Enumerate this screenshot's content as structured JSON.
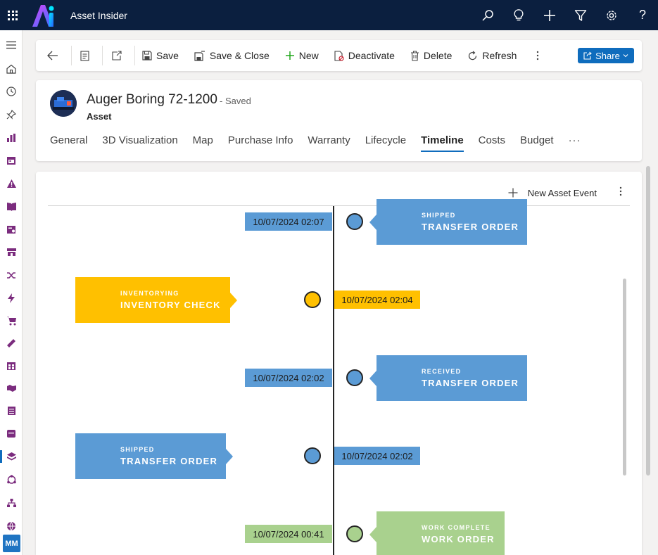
{
  "app": {
    "title": "Asset Insider"
  },
  "topbar": {
    "icons": [
      "search-icon",
      "lightbulb-icon",
      "plus-icon",
      "filter-icon",
      "settings-icon",
      "help-icon"
    ],
    "help_label": "?"
  },
  "user": {
    "initials": "MM"
  },
  "commandbar": {
    "save": "Save",
    "save_close": "Save & Close",
    "new": "New",
    "deactivate": "Deactivate",
    "delete": "Delete",
    "refresh": "Refresh",
    "share": "Share"
  },
  "record": {
    "title": "Auger Boring 72-1200",
    "status": "- Saved",
    "type": "Asset"
  },
  "tabs": [
    {
      "label": "General"
    },
    {
      "label": "3D Visualization"
    },
    {
      "label": "Map"
    },
    {
      "label": "Purchase Info"
    },
    {
      "label": "Warranty"
    },
    {
      "label": "Lifecycle"
    },
    {
      "label": "Timeline",
      "active": true
    },
    {
      "label": "Costs"
    },
    {
      "label": "Budget"
    }
  ],
  "tabs_more": "···",
  "timeline": {
    "new_event_label": "New Asset Event",
    "colors": {
      "blue": "#5b9bd5",
      "yellow": "#ffc000",
      "green": "#a9d18e"
    },
    "events": [
      {
        "date": "10/07/2024 02:07",
        "type": "SHIPPED",
        "name": "TRANSFER ORDER",
        "color": "#5b9bd5",
        "side": "right"
      },
      {
        "date": "10/07/2024 02:04",
        "type": "INVENTORYING",
        "name": "INVENTORY CHECK",
        "color": "#ffc000",
        "side": "left"
      },
      {
        "date": "10/07/2024 02:02",
        "type": "RECEIVED",
        "name": "TRANSFER ORDER",
        "color": "#5b9bd5",
        "side": "right"
      },
      {
        "date": "10/07/2024 02:02",
        "type": "SHIPPED",
        "name": "TRANSFER ORDER",
        "color": "#5b9bd5",
        "side": "left"
      },
      {
        "date": "10/07/2024 00:41",
        "type": "WORK COMPLETE",
        "name": "WORK ORDER",
        "color": "#a9d18e",
        "side": "right"
      }
    ]
  }
}
